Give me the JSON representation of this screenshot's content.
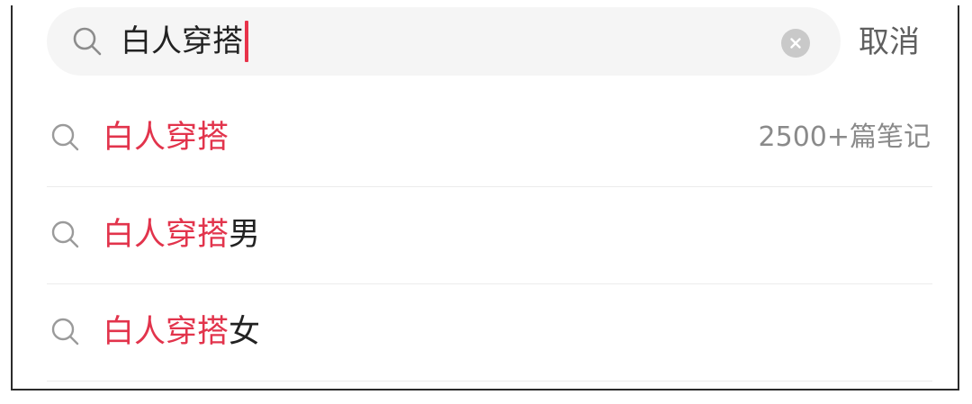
{
  "search": {
    "query": "白人穿搭",
    "search_icon": "search-icon",
    "clear_icon": "close-circle-icon",
    "cancel_label": "取消",
    "accent_color": "#e2344c"
  },
  "suggestions": [
    {
      "highlight": "白人穿搭",
      "rest": "",
      "count": "2500+篇笔记",
      "icon": "search-icon"
    },
    {
      "highlight": "白人穿搭",
      "rest": "男",
      "count": "",
      "icon": "search-icon"
    },
    {
      "highlight": "白人穿搭",
      "rest": "女",
      "count": "",
      "icon": "search-icon"
    }
  ]
}
